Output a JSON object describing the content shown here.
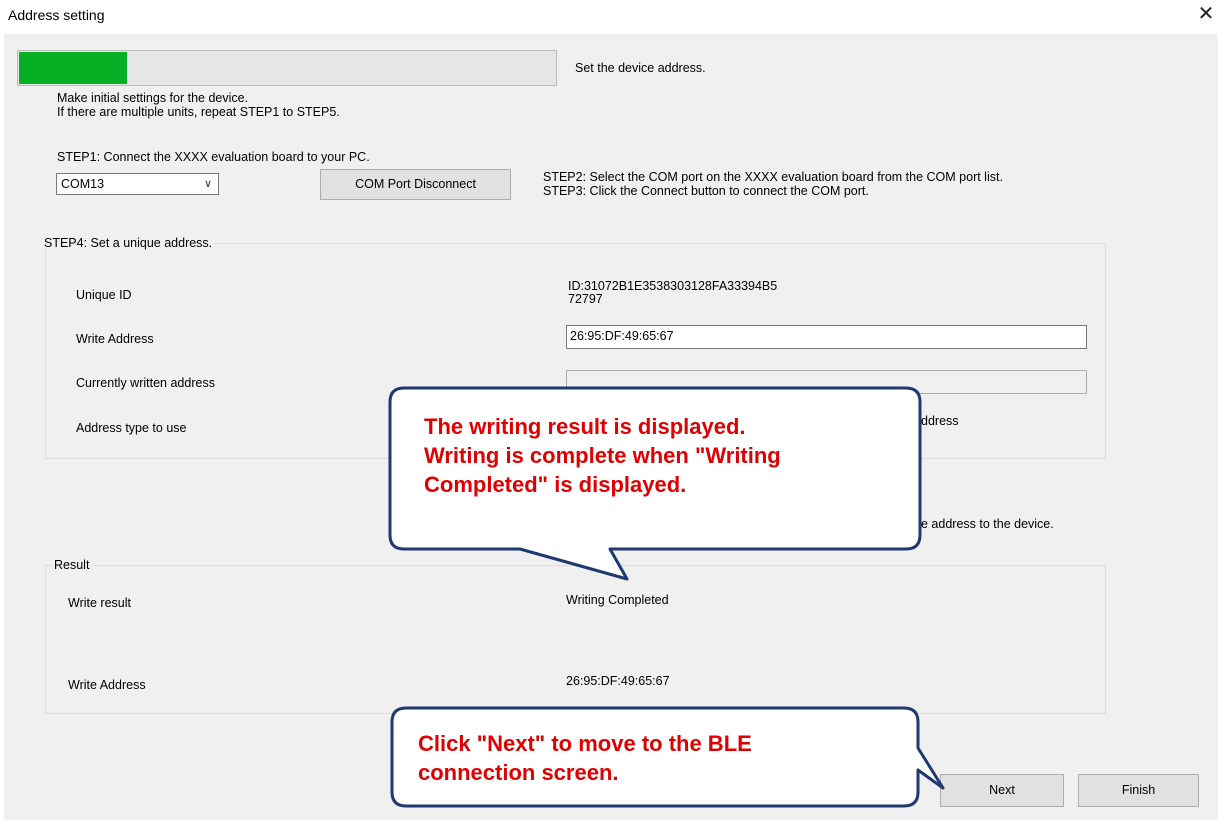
{
  "window": {
    "title": "Address setting",
    "close_glyph": "✕"
  },
  "progress": {
    "value_fraction": 0.2,
    "label": "Set the device address.",
    "fill_color": "#06b025"
  },
  "intro": {
    "line1": "Make initial settings for the device.",
    "line2": "If there are multiple units, repeat STEP1 to STEP5."
  },
  "step1": {
    "label": "STEP1: Connect the XXXX evaluation board to your PC."
  },
  "com_port": {
    "selected": "COM13",
    "disconnect_label": "COM Port Disconnect"
  },
  "step23": {
    "line1": "STEP2: Select the COM port on the XXXX evaluation board from the COM port list.",
    "line2": "STEP3: Click the Connect button to connect the COM port."
  },
  "step4": {
    "title": "STEP4: Set a unique address.",
    "unique_id_label": "Unique ID",
    "unique_id_value_line1": "ID:31072B1E3538303128FA33394B5",
    "unique_id_value_line2": "72797",
    "write_address_label": "Write Address",
    "write_address_value": "26:95:DF:49:65:67",
    "current_address_label": "Currently written address",
    "current_address_value": "",
    "address_type_label": "Address type to use",
    "address_type_visible_fragment": "ddress"
  },
  "step5_fragment": "e address to the device.",
  "result": {
    "title": "Result",
    "write_result_label": "Write result",
    "write_result_value": "Writing Completed",
    "write_address_label": "Write Address",
    "write_address_value": "26:95:DF:49:65:67"
  },
  "buttons": {
    "next": "Next",
    "finish": "Finish"
  },
  "callouts": {
    "result_lines": [
      "The writing result is displayed.",
      "Writing is complete when \"Writing",
      "Completed\" is displayed."
    ],
    "next_lines": [
      "Click \"Next\" to move to the BLE",
      "connection screen."
    ],
    "text_color": "#e00000",
    "border_color": "#1f3a6e"
  }
}
